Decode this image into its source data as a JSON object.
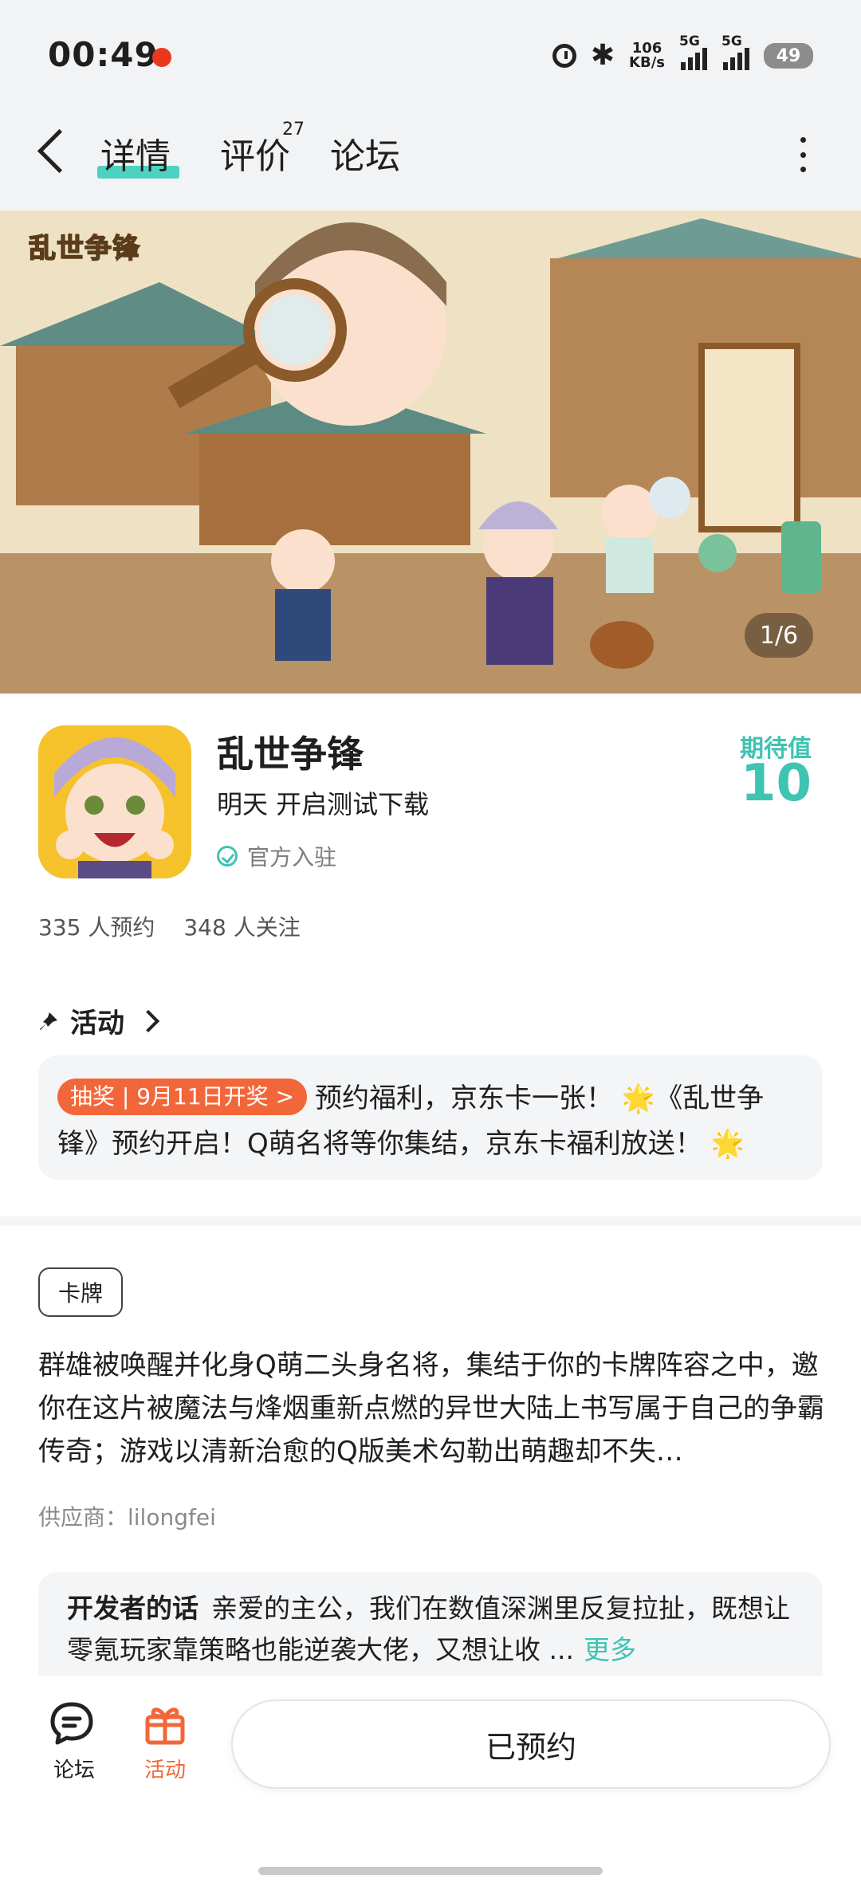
{
  "status_bar": {
    "time": "00:49",
    "net_speed_value": "106",
    "net_speed_unit": "KB/s",
    "sim1_label": "5G",
    "sim2_label": "5G",
    "battery": "49",
    "icons": [
      "notification-dot-icon",
      "alarm-icon",
      "bluetooth-icon",
      "signal-icon",
      "battery-icon"
    ]
  },
  "nav": {
    "tabs": [
      {
        "label": "详情",
        "active": true
      },
      {
        "label": "评价",
        "badge": "27"
      },
      {
        "label": "论坛"
      }
    ]
  },
  "banner": {
    "logo_text": "乱世争锋",
    "counter": "1/6"
  },
  "game": {
    "name": "乱世争锋",
    "subtitle": "明天 开启测试下载",
    "verified_label": "官方入驻",
    "expect_label": "期待值",
    "expect_value": "10",
    "reservations": "335 人预约",
    "followers": "348 人关注"
  },
  "activity": {
    "title": "活动",
    "tag": "抽奖 | 9月11日开奖 >",
    "text": "预约福利，京东卡一张！ 🌟《乱世争锋》预约开启！Q萌名将等你集结，京东卡福利放送！ 🌟"
  },
  "details": {
    "genre_tag": "卡牌",
    "description": "群雄被唤醒并化身Q萌二头身名将，集结于你的卡牌阵容之中，邀你在这片被魔法与烽烟重新点燃的异世大陆上书写属于自己的争霸传奇；游戏以清新治愈的Q版美术勾勒出萌趣却不失…",
    "supplier": "供应商：lilongfei",
    "developer_label": "开发者的话",
    "developer_text": "亲爱的主公，我们在数值深渊里反复拉扯，既想让零氪玩家靠策略也能逆袭大佬，又想让收 ...",
    "developer_more": "更多"
  },
  "bottom": {
    "forum_label": "论坛",
    "activity_label": "活动",
    "reserve_label": "已预约"
  },
  "colors": {
    "accent": "#4cd2c0",
    "teal_text": "#3fc3b2",
    "orange": "#f2673a",
    "status_bg": "#f2f3f5"
  }
}
